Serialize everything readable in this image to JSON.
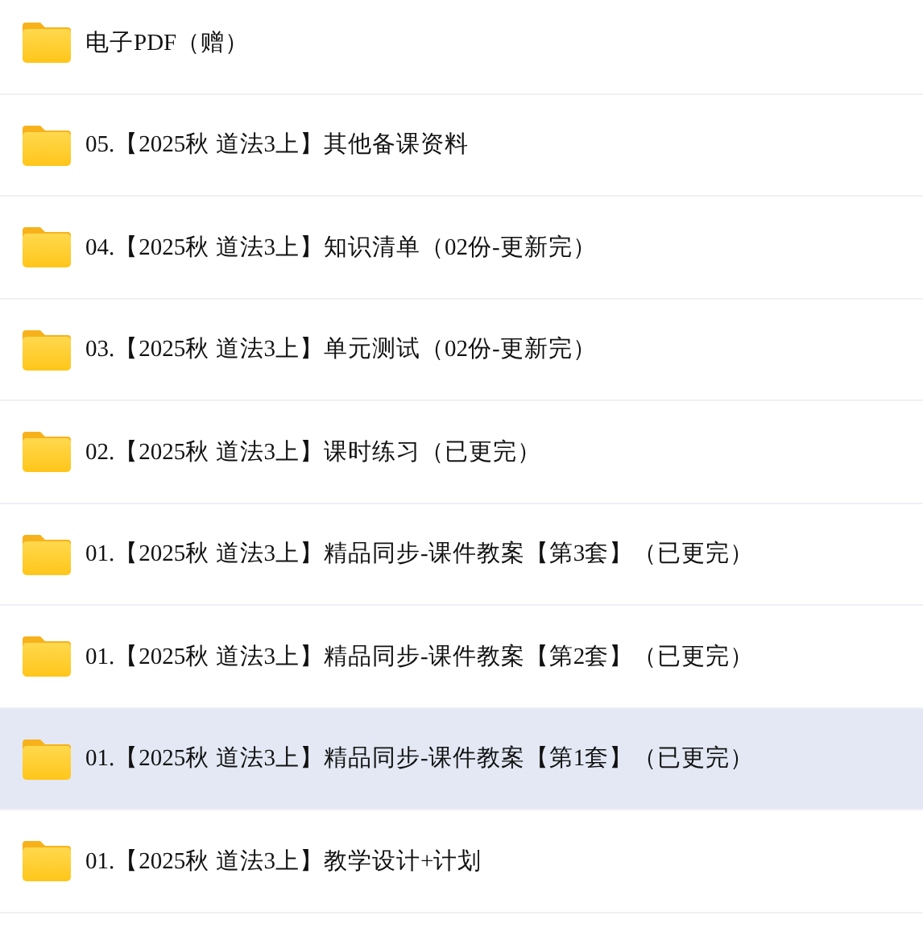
{
  "folders": [
    {
      "name": "电子PDF（赠）",
      "selected": false
    },
    {
      "name": "05.【2025秋 道法3上】其他备课资料",
      "selected": false
    },
    {
      "name": "04.【2025秋 道法3上】知识清单（02份-更新完）",
      "selected": false
    },
    {
      "name": "03.【2025秋 道法3上】单元测试（02份-更新完）",
      "selected": false
    },
    {
      "name": "02.【2025秋 道法3上】课时练习（已更完）",
      "selected": false
    },
    {
      "name": "01.【2025秋 道法3上】精品同步-课件教案【第3套】（已更完）",
      "selected": false
    },
    {
      "name": "01.【2025秋 道法3上】精品同步-课件教案【第2套】（已更完）",
      "selected": false
    },
    {
      "name": "01.【2025秋 道法3上】精品同步-课件教案【第1套】（已更完）",
      "selected": true
    },
    {
      "name": "01.【2025秋 道法3上】教学设计+计划",
      "selected": false
    }
  ]
}
